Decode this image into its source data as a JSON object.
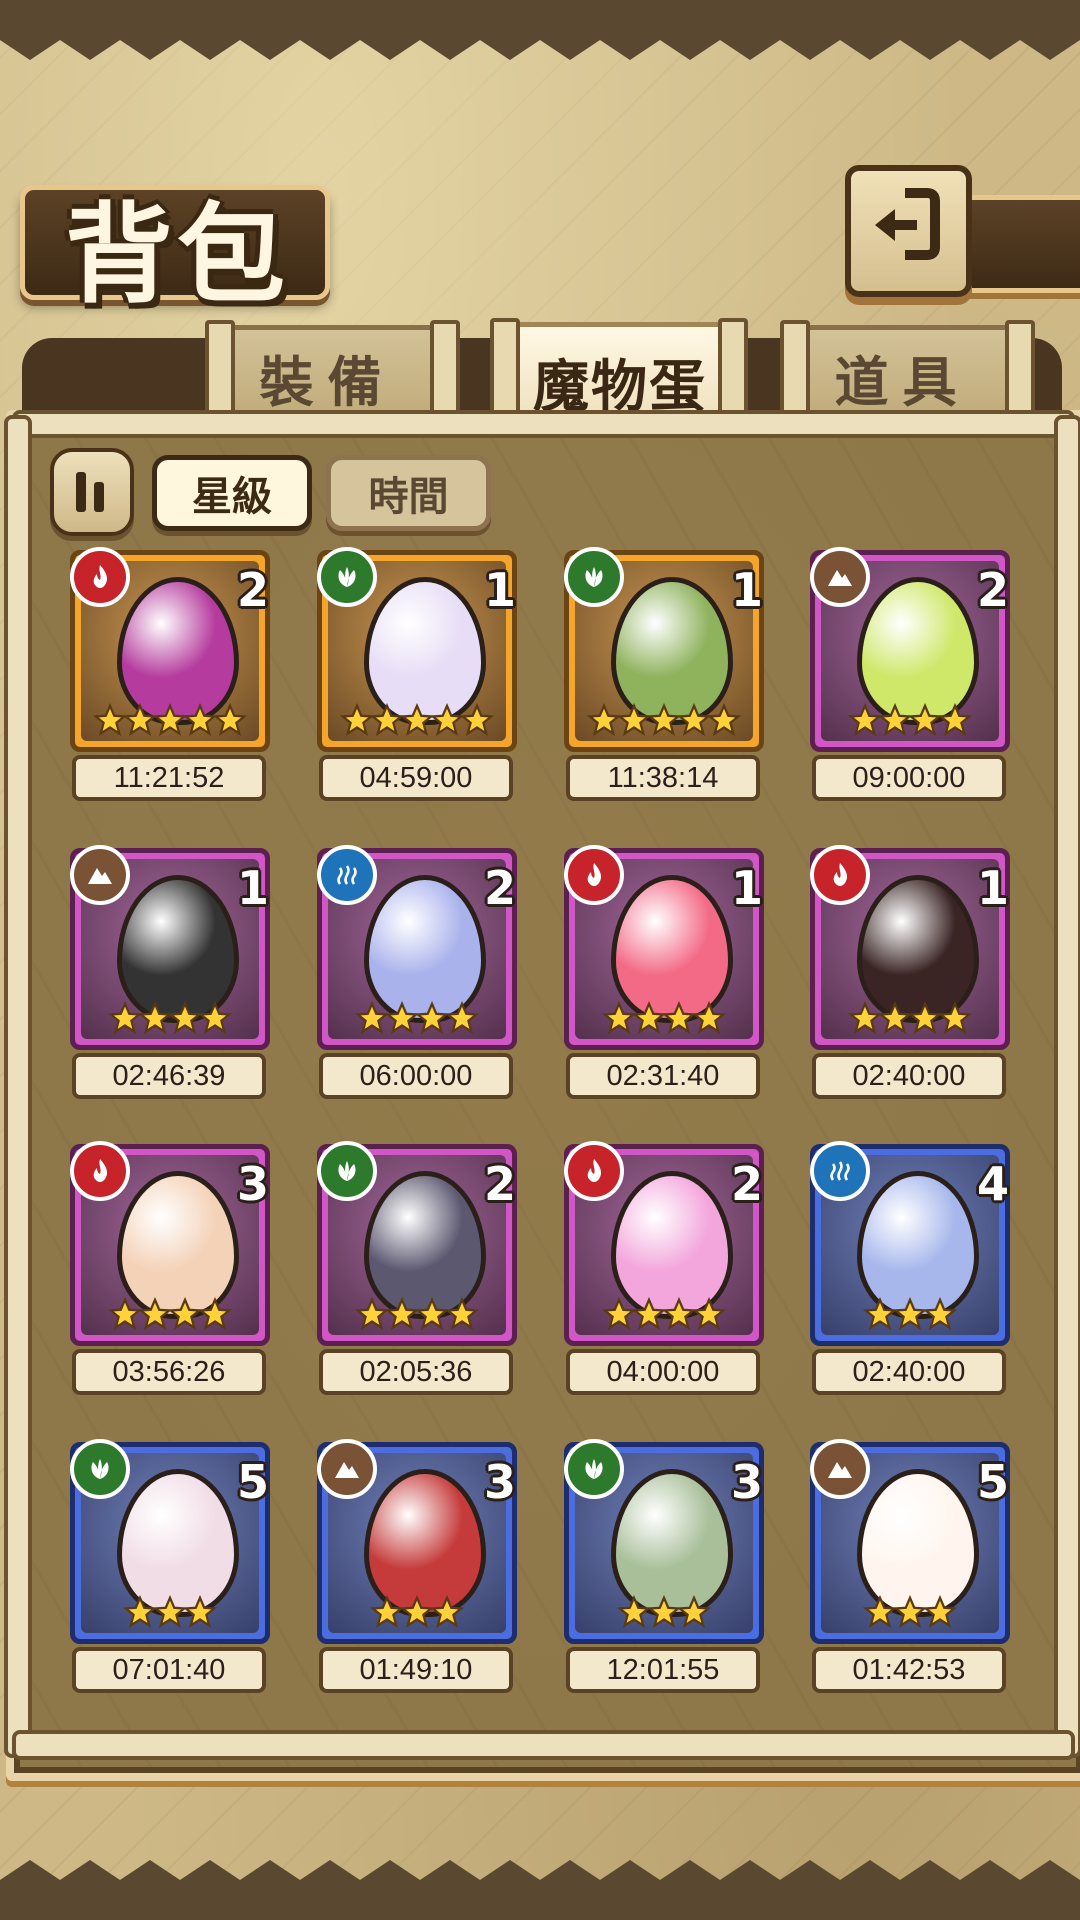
{
  "header": {
    "title": "背包",
    "back_icon": "return-arrow-icon"
  },
  "tabs": [
    {
      "label": "裝備",
      "active": false
    },
    {
      "label": "魔物蛋",
      "active": true
    },
    {
      "label": "道具",
      "active": false
    }
  ],
  "sort": {
    "icon": "pause-sort-icon",
    "star_label": "星級",
    "time_label": "時間",
    "active": "星級"
  },
  "colors": {
    "fire": "#c6232a",
    "wood": "#2d7a2d",
    "earth": "#7a5236",
    "water": "#1f73b8",
    "gold_frame": "#f4a52a",
    "pink_frame": "#d156c6",
    "blue_frame": "#4b6de0",
    "star": "#ffd23a"
  },
  "eggs": [
    {
      "element": "fire",
      "count": "2",
      "stars": 5,
      "frame": "gold",
      "timer": "11:21:52",
      "egg_color": "#b53c9e"
    },
    {
      "element": "wood",
      "count": "1",
      "stars": 5,
      "frame": "gold",
      "timer": "04:59:00",
      "egg_color": "#e7ddf6"
    },
    {
      "element": "wood",
      "count": "1",
      "stars": 5,
      "frame": "gold",
      "timer": "11:38:14",
      "egg_color": "#8fb25c"
    },
    {
      "element": "earth",
      "count": "2",
      "stars": 4,
      "frame": "pink",
      "timer": "09:00:00",
      "egg_color": "#cfe86a"
    },
    {
      "element": "earth",
      "count": "1",
      "stars": 4,
      "frame": "pink",
      "timer": "02:46:39",
      "egg_color": "#333333"
    },
    {
      "element": "water",
      "count": "2",
      "stars": 4,
      "frame": "pink",
      "timer": "06:00:00",
      "egg_color": "#aab2ec"
    },
    {
      "element": "fire",
      "count": "1",
      "stars": 4,
      "frame": "pink",
      "timer": "02:31:40",
      "egg_color": "#f36a86"
    },
    {
      "element": "fire",
      "count": "1",
      "stars": 4,
      "frame": "pink",
      "timer": "02:40:00",
      "egg_color": "#3a2424"
    },
    {
      "element": "fire",
      "count": "3",
      "stars": 4,
      "frame": "pink",
      "timer": "03:56:26",
      "egg_color": "#f4d2b8"
    },
    {
      "element": "wood",
      "count": "2",
      "stars": 4,
      "frame": "pink",
      "timer": "02:05:36",
      "egg_color": "#5b5870"
    },
    {
      "element": "fire",
      "count": "2",
      "stars": 4,
      "frame": "pink",
      "timer": "04:00:00",
      "egg_color": "#f3a6dc"
    },
    {
      "element": "water",
      "count": "4",
      "stars": 3,
      "frame": "blue",
      "timer": "02:40:00",
      "egg_color": "#a7b7ec"
    },
    {
      "element": "wood",
      "count": "5",
      "stars": 3,
      "frame": "blue",
      "timer": "07:01:40",
      "egg_color": "#f1dde6"
    },
    {
      "element": "earth",
      "count": "3",
      "stars": 3,
      "frame": "blue",
      "timer": "01:49:10",
      "egg_color": "#c53b3b"
    },
    {
      "element": "wood",
      "count": "3",
      "stars": 3,
      "frame": "blue",
      "timer": "12:01:55",
      "egg_color": "#a9bf9a"
    },
    {
      "element": "earth",
      "count": "5",
      "stars": 3,
      "frame": "blue",
      "timer": "01:42:53",
      "egg_color": "#fff5ee"
    }
  ]
}
